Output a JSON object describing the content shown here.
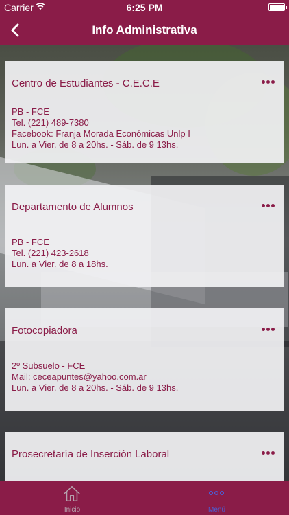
{
  "status_bar": {
    "carrier": "Carrier",
    "time": "6:25 PM",
    "wifi_icon": "wifi-icon",
    "battery_icon": "battery-icon"
  },
  "nav": {
    "title": "Info Administrativa",
    "back_icon": "chevron-left-icon"
  },
  "colors": {
    "brand": "#8a1c48",
    "card_bg": "#f1f1f3",
    "active_tab": "#4b5fd6",
    "inactive_tab": "#b5a0ac"
  },
  "cards": [
    {
      "name": "Centro de Estudiantes - C.E.C.E",
      "lines": [
        "PB - FCE",
        "Tel. (221) 489-7380",
        "Facebook: Franja Morada Económicas Unlp I",
        " Lun. a Vier. de 8 a 20hs. - Sáb. de 9 13hs."
      ]
    },
    {
      "name": "Departamento de Alumnos",
      "lines": [
        "PB - FCE",
        "Tel. (221) 423-2618",
        " Lun. a Vier. de 8 a 18hs."
      ]
    },
    {
      "name": "Fotocopiadora",
      "lines": [
        "2º Subsuelo - FCE",
        "Mail: ceceapuntes@yahoo.com.ar",
        " Lun. a Vier. de 8 a 20hs. - Sáb. de 9 13hs."
      ]
    },
    {
      "name": "Prosecretaría de Inserción Laboral",
      "lines": []
    }
  ],
  "tabs": [
    {
      "label": "Inicio",
      "icon": "home-icon"
    },
    {
      "label": "Menú",
      "icon": "more-icon"
    }
  ]
}
